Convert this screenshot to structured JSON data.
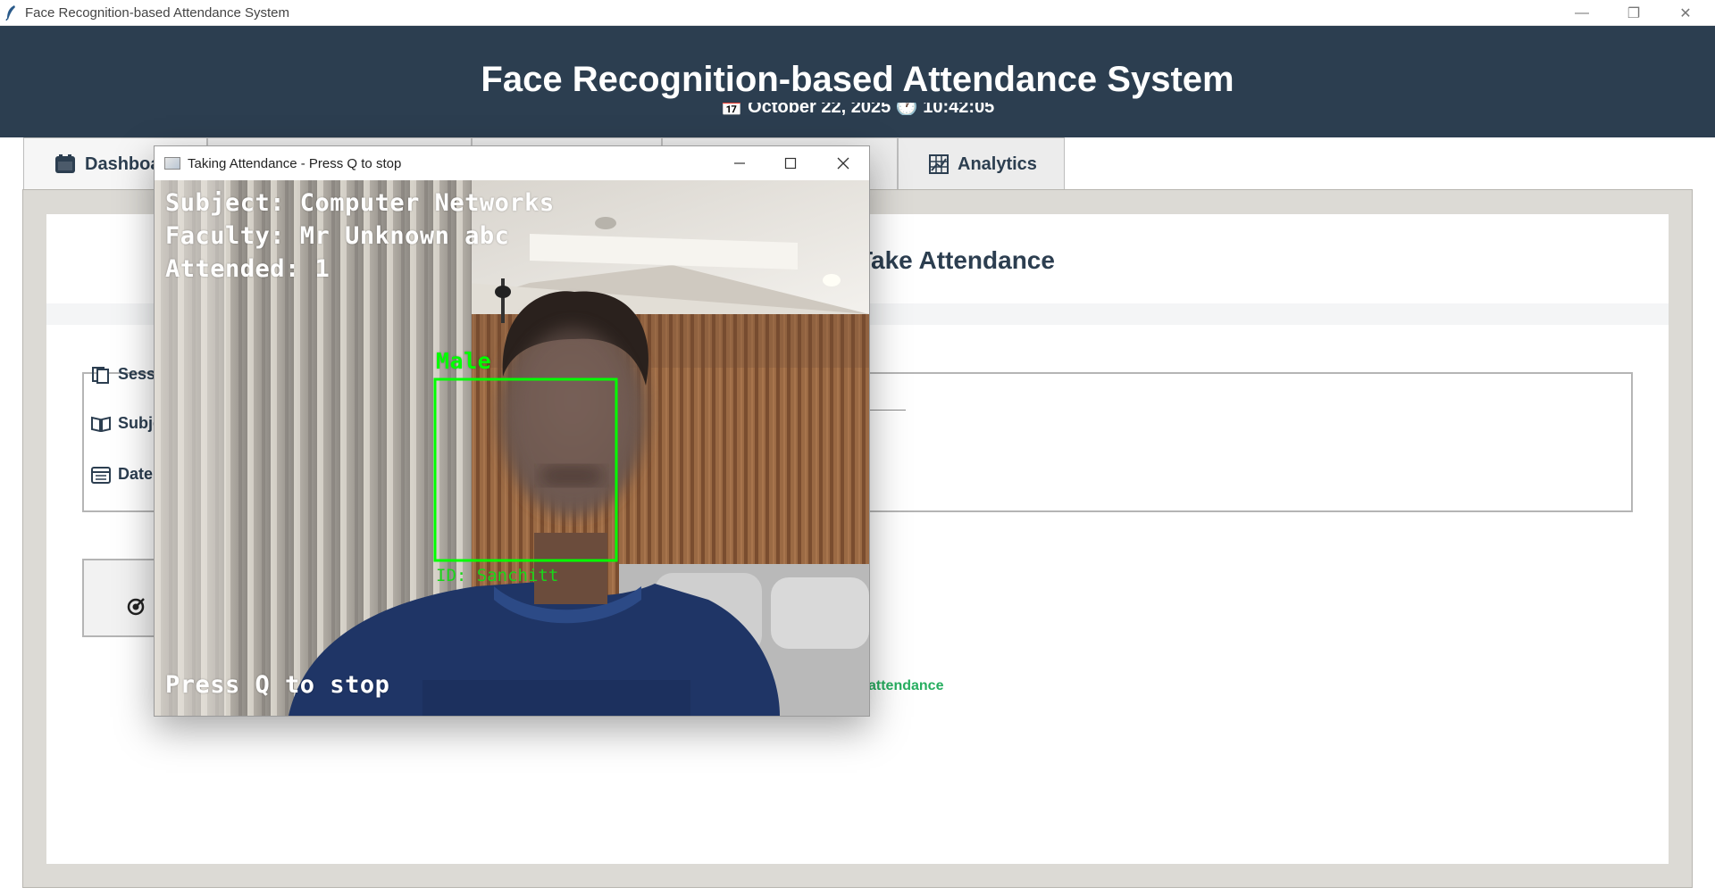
{
  "window": {
    "title": "Face Recognition-based Attendance System",
    "controls": {
      "minimize": "—",
      "restore": "❐",
      "close": "✕"
    }
  },
  "header": {
    "title": "Face Recognition-based Attendance System",
    "subtitle": "📅 October 22, 2025   🕐 10:42:05"
  },
  "tabs": [
    {
      "label": "Dashboard",
      "icon": "dashboard-icon"
    },
    {
      "label": "",
      "icon": ""
    },
    {
      "label": "",
      "icon": ""
    },
    {
      "label": "",
      "icon": ""
    },
    {
      "label": "Analytics",
      "icon": "analytics-icon"
    }
  ],
  "main": {
    "heading": "Take Attendance",
    "fields": [
      {
        "label": "Session",
        "icon": "session-icon"
      },
      {
        "label": "Subject",
        "icon": "book-icon"
      },
      {
        "label": "Date",
        "icon": "calendar-icon"
      }
    ],
    "status": "attendance"
  },
  "camera_window": {
    "title": "Taking Attendance - Press Q to stop",
    "overlay": {
      "subject": "Subject: Computer Networks",
      "faculty": "Faculty: Mr Unknown abc",
      "attended": "Attended: 1",
      "gender": "Male",
      "id": "ID: Sanchitt",
      "hint": "Press Q to stop"
    }
  },
  "colors": {
    "header_bg": "#2c3e50",
    "detection_box": "#00ff00",
    "status_green": "#27ae60"
  }
}
